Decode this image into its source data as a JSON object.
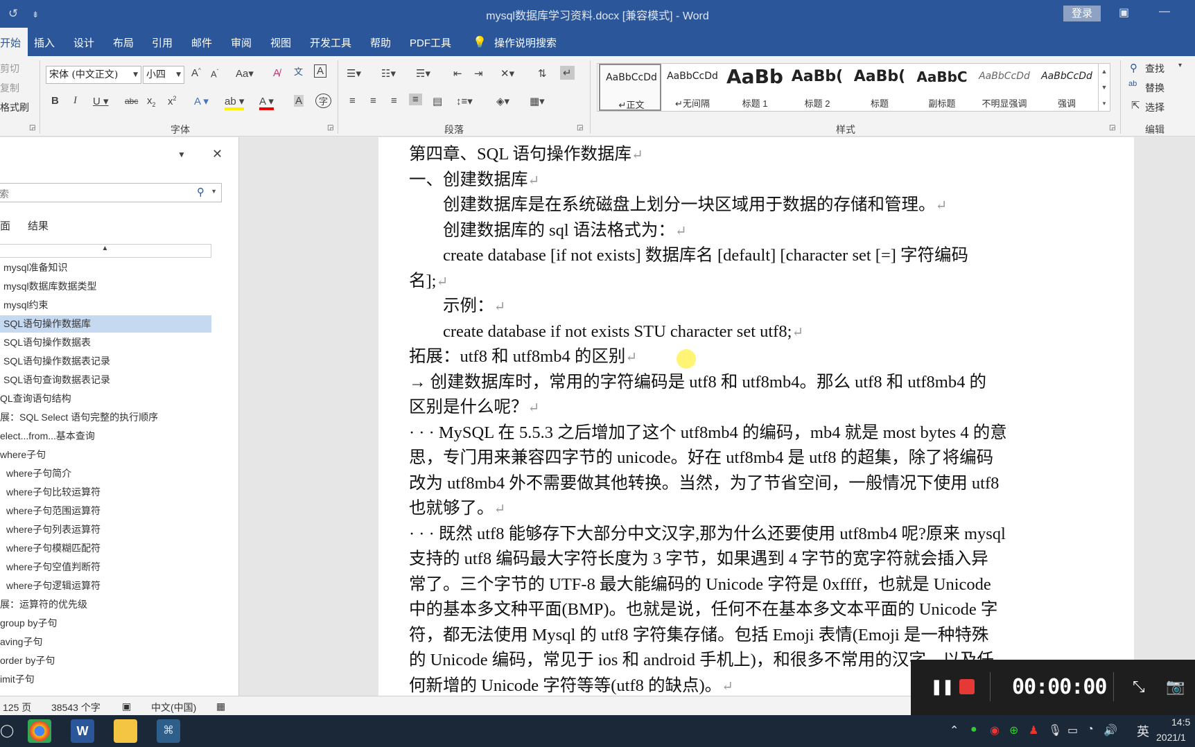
{
  "window": {
    "title": "mysql数据库学习资料.docx [兼容模式] - Word",
    "login": "登录",
    "qa_undo": "↺",
    "qa_more": "⇟"
  },
  "tabs": [
    "开始",
    "插入",
    "设计",
    "布局",
    "引用",
    "邮件",
    "审阅",
    "视图",
    "开发工具",
    "帮助",
    "PDF工具"
  ],
  "tellme": "操作说明搜索",
  "ribbon": {
    "clipboard": {
      "cut": "剪切",
      "copy": "复制",
      "format_painter": "格式刷"
    },
    "font": {
      "name": "宋体 (中文正文)",
      "size": "小四",
      "group": "字体"
    },
    "paragraph": {
      "group": "段落"
    },
    "styles": {
      "group": "样式",
      "items": [
        {
          "preview": "AaBbCcDd",
          "name": "↵正文"
        },
        {
          "preview": "AaBbCcDd",
          "name": "↵无间隔"
        },
        {
          "preview": "AaBb",
          "name": "标题 1"
        },
        {
          "preview": "AaBb(",
          "name": "标题 2"
        },
        {
          "preview": "AaBb(",
          "name": "标题"
        },
        {
          "preview": "AaBbC",
          "name": "副标题"
        },
        {
          "preview": "AaBbCcDd",
          "name": "不明显强调"
        },
        {
          "preview": "AaBbCcDd",
          "name": "强调"
        }
      ]
    },
    "editing": {
      "group": "编辑",
      "find": "查找",
      "replace": "替换",
      "select": "选择"
    }
  },
  "nav": {
    "search_placeholder": "索",
    "tab_pages": "面",
    "tab_results": "结果",
    "items": [
      "mysql准备知识",
      "mysql数据库数据类型",
      "mysql约束",
      "SQL语句操作数据库",
      "SQL语句操作数据表",
      "SQL语句操作数据表记录",
      "SQL语句查询数据表记录",
      "QL查询语句结构",
      "展：SQL Select 语句完整的执行顺序",
      "elect...from...基本查询",
      "where子句",
      "where子句简介",
      "where子句比较运算符",
      "where子句范围运算符",
      "where子句列表运算符",
      "where子句模糊匹配符",
      "where子句空值判断符",
      "where子句逻辑运算符",
      "展：运算符的优先级",
      "group by子句",
      "aving子句",
      "order by子句",
      "imit子句"
    ]
  },
  "doc": {
    "lines": [
      "第四章、SQL 语句操作数据库",
      "一、创建数据库",
      "　　创建数据库是在系统磁盘上划分一块区域用于数据的存储和管理。",
      "　　创建数据库的 sql 语法格式为：",
      "　　create database [if not exists] 数据库名 [default] [character set [=] 字符编码",
      "名];",
      "　　示例：",
      "　　create database if not exists STU character set utf8;",
      "拓展：utf8 和 utf8mb4 的区别",
      " → 创建数据库时，常用的字符编码是 utf8 和 utf8mb4。那么 utf8 和 utf8mb4 的",
      "区别是什么呢？",
      "· · · MySQL 在 5.5.3 之后增加了这个 utf8mb4 的编码，mb4 就是 most bytes 4 的意",
      "思，专门用来兼容四字节的 unicode。好在 utf8mb4 是 utf8 的超集，除了将编码",
      "改为 utf8mb4 外不需要做其他转换。当然，为了节省空间，一般情况下使用 utf8",
      "也就够了。",
      "· · · 既然 utf8 能够存下大部分中文汉字,那为什么还要使用 utf8mb4 呢?原来 mysql",
      "支持的 utf8 编码最大字符长度为 3 字节，如果遇到 4 字节的宽字符就会插入异",
      "常了。三个字节的 UTF-8 最大能编码的 Unicode 字符是 0xffff，也就是 Unicode",
      "中的基本多文种平面(BMP)。也就是说，任何不在基本多文本平面的 Unicode 字",
      "符，都无法使用 Mysql 的 utf8 字符集存储。包括 Emoji 表情(Emoji 是一种特殊",
      "的 Unicode 编码，常见于 ios 和 android 手机上)，和很多不常用的汉字，以及任",
      "何新增的 Unicode 字符等等(utf8 的缺点)。"
    ],
    "mark": "↵"
  },
  "status": {
    "pages": "125 页",
    "words": "38543 个字",
    "lang": "中文(中国)"
  },
  "recorder": {
    "time": "00:00:00"
  },
  "taskbar": {
    "ime": "英",
    "time": "14:5",
    "date": "2021/1"
  }
}
